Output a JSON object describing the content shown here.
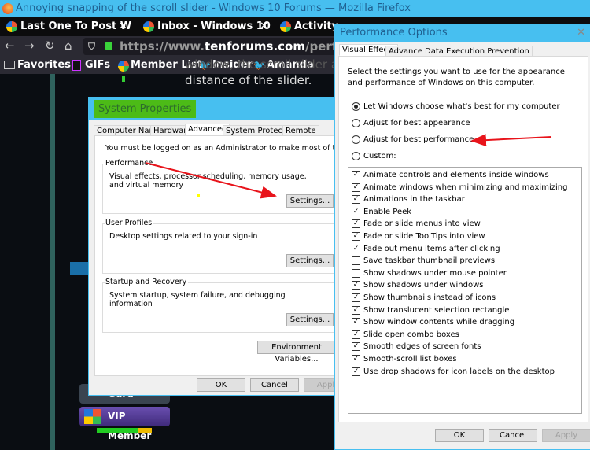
{
  "browser": {
    "window_title": "Annoying snapping of the scroll slider - Windows 10 Forums — Mozilla Firefox",
    "tabs": [
      {
        "label": "Last One To Post W"
      },
      {
        "label": "Inbox - Windows 10"
      },
      {
        "label": "Activity"
      }
    ],
    "url_prefix": "https://www.",
    "url_domain": "tenforums.com",
    "url_suffix": "/performa",
    "bookmarks": [
      {
        "label": "Favorites",
        "icon": "folder-icon"
      },
      {
        "label": "GIFs",
        "icon": "gif-icon"
      },
      {
        "label": "Member List",
        "icon": "tenforums-icon"
      },
      {
        "label": "Insider",
        "icon": "twitter-icon"
      },
      {
        "label": "Amanda",
        "icon": "twitter-icon"
      }
    ]
  },
  "page": {
    "text_line1": "window, the scroll slider and",
    "text_line2": "distance of the slider.",
    "badge_gold": "Guru",
    "badge_vip": "VIP Member"
  },
  "system_properties": {
    "title": "System Properties",
    "tabs": [
      "Computer Name",
      "Hardware",
      "Advanced",
      "System Protection",
      "Remote"
    ],
    "active_tab": "Advanced",
    "admin_note": "You must be logged on as an Administrator to make most of these changes.",
    "groups": [
      {
        "label": "Performance",
        "desc": "Visual effects, processor scheduling, memory usage, and virtual memory",
        "button": "Settings..."
      },
      {
        "label": "User Profiles",
        "desc": "Desktop settings related to your sign-in",
        "button": "Settings..."
      },
      {
        "label": "Startup and Recovery",
        "desc": "System startup, system failure, and debugging information",
        "button": "Settings..."
      }
    ],
    "env_button": "Environment Variables...",
    "ok": "OK",
    "cancel": "Cancel",
    "apply": "Apply"
  },
  "performance_options": {
    "title": "Performance Options",
    "close": "✕",
    "tabs": [
      "Visual Effects",
      "Advanced",
      "Data Execution Prevention"
    ],
    "active_tab": "Visual Effects",
    "intro": "Select the settings you want to use for the appearance and performance of Windows on this computer.",
    "radios": [
      {
        "label": "Let Windows choose what's best for my computer",
        "selected": true
      },
      {
        "label": "Adjust for best appearance",
        "selected": false
      },
      {
        "label": "Adjust for best performance",
        "selected": false
      },
      {
        "label": "Custom:",
        "selected": false
      }
    ],
    "options": [
      {
        "label": "Animate controls and elements inside windows",
        "checked": true
      },
      {
        "label": "Animate windows when minimizing and maximizing",
        "checked": true
      },
      {
        "label": "Animations in the taskbar",
        "checked": true
      },
      {
        "label": "Enable Peek",
        "checked": true
      },
      {
        "label": "Fade or slide menus into view",
        "checked": true
      },
      {
        "label": "Fade or slide ToolTips into view",
        "checked": true
      },
      {
        "label": "Fade out menu items after clicking",
        "checked": true
      },
      {
        "label": "Save taskbar thumbnail previews",
        "checked": false
      },
      {
        "label": "Show shadows under mouse pointer",
        "checked": false
      },
      {
        "label": "Show shadows under windows",
        "checked": true
      },
      {
        "label": "Show thumbnails instead of icons",
        "checked": true
      },
      {
        "label": "Show translucent selection rectangle",
        "checked": true
      },
      {
        "label": "Show window contents while dragging",
        "checked": true
      },
      {
        "label": "Slide open combo boxes",
        "checked": true
      },
      {
        "label": "Smooth edges of screen fonts",
        "checked": true
      },
      {
        "label": "Smooth-scroll list boxes",
        "checked": true
      },
      {
        "label": "Use drop shadows for icon labels on the desktop",
        "checked": true
      }
    ],
    "ok": "OK",
    "cancel": "Cancel",
    "apply": "Apply"
  },
  "colors": {
    "titlebar": "#47bff0",
    "highlight": "#4cbb17",
    "annotation_arrow": "#e8141b"
  }
}
